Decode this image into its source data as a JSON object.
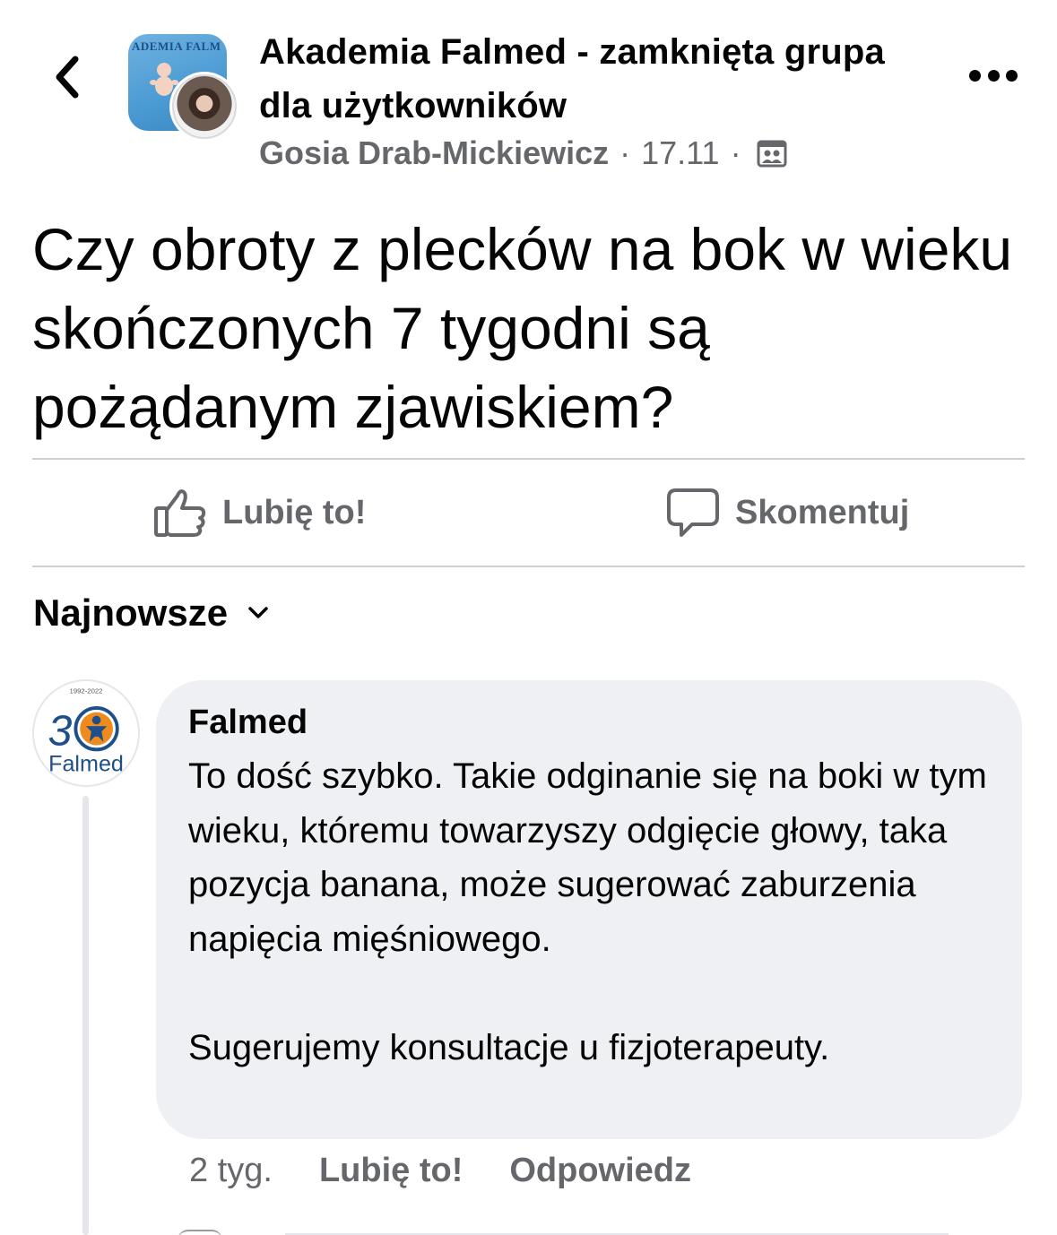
{
  "header": {
    "group_name": "Akademia Falmed - zamknięta grupa dla użytkowników",
    "group_avatar_label": "ADEMIA FALM",
    "author": "Gosia Drab-Mickiewicz",
    "separator": "·",
    "date": "17.11",
    "audience_icon": "group-icon",
    "back_icon": "chevron-left-icon",
    "more_icon": "more-horizontal-icon"
  },
  "post": {
    "text": "Czy obroty z plecków na bok w wieku skończonych 7 tygodni są pożądanym zjawiskiem?"
  },
  "actions": {
    "like_label": "Lubię to!",
    "comment_label": "Skomentuj"
  },
  "sort": {
    "label": "Najnowsze"
  },
  "comments": [
    {
      "author": "Falmed",
      "avatar_badge_years": "1992-2022",
      "avatar_number": "30",
      "avatar_brand": "Falmed",
      "body": "To dość szybko. Takie odginanie się na boki w tym wieku, któremu towarzyszy odgięcie głowy, taka pozycja banana, może sugerować zaburzenia napięcia mięśniowego.\n\nSugerujemy konsultacje u fizjoterapeuty.",
      "time": "2 tyg.",
      "like_label": "Lubię to!",
      "reply_label": "Odpowiedz"
    }
  ],
  "colors": {
    "text_primary": "#050505",
    "text_secondary": "#65676b",
    "bubble": "#eef0f3",
    "divider": "#ced0d4",
    "brand_blue": "#1d4f8a",
    "brand_orange": "#f08a1c"
  }
}
